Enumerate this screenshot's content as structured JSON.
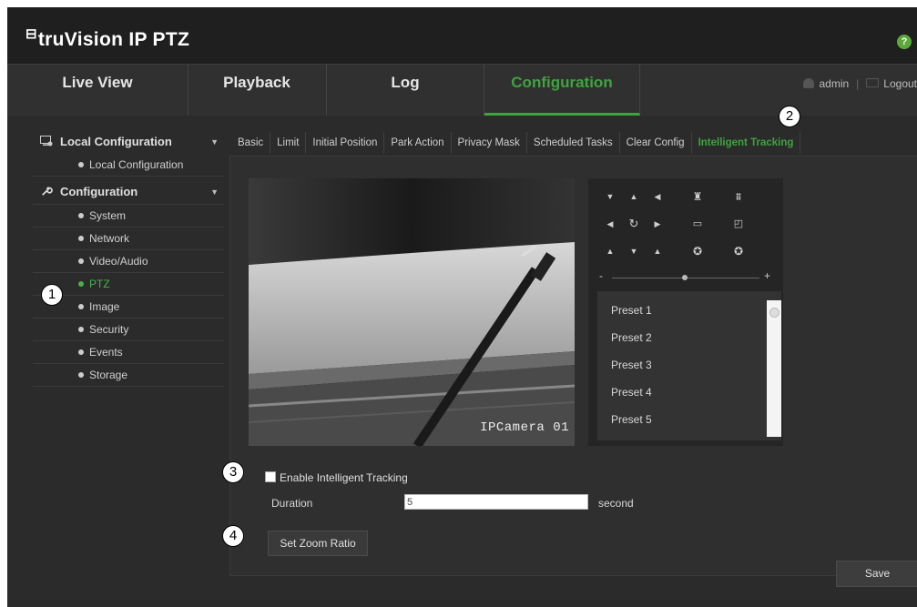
{
  "app": {
    "title": "truVision IP PTZ",
    "help": "?"
  },
  "nav": {
    "tabs": [
      "Live View",
      "Playback",
      "Log",
      "Configuration"
    ],
    "active": "Configuration",
    "user": "admin",
    "logout": "Logout"
  },
  "sidebar": {
    "groups": [
      {
        "label": "Local Configuration",
        "items": [
          "Local Configuration"
        ]
      },
      {
        "label": "Configuration",
        "items": [
          "System",
          "Network",
          "Video/Audio",
          "PTZ",
          "Image",
          "Security",
          "Events",
          "Storage"
        ]
      }
    ],
    "active_item": "PTZ"
  },
  "subtabs": [
    "Basic",
    "Limit",
    "Initial Position",
    "Park Action",
    "Privacy Mask",
    "Scheduled Tasks",
    "Clear Config",
    "Intelligent Tracking"
  ],
  "active_subtab": "Intelligent Tracking",
  "video": {
    "osd": "IPCamera 01"
  },
  "ptz": {
    "zoom_minus": "-",
    "zoom_plus": "+",
    "presets": [
      "Preset 1",
      "Preset 2",
      "Preset 3",
      "Preset 4",
      "Preset 5"
    ]
  },
  "form": {
    "enable_label": "Enable Intelligent Tracking",
    "enable_checked": false,
    "duration_label": "Duration",
    "duration_value": "5",
    "duration_unit": "second",
    "zoom_button": "Set Zoom Ratio",
    "save_button": "Save"
  },
  "callouts": [
    "1",
    "2",
    "3",
    "4"
  ],
  "colors": {
    "accent": "#3fa33f",
    "background": "#2b2b2b"
  }
}
